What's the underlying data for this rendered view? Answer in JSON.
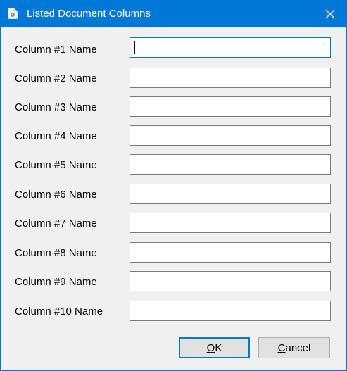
{
  "window": {
    "title": "Listed Document Columns",
    "accent_color": "#0078d7",
    "icon": "document-gear-icon",
    "close_icon": "close-icon"
  },
  "fields": [
    {
      "label": "Column #1 Name",
      "value": "",
      "focused": true
    },
    {
      "label": "Column #2 Name",
      "value": ""
    },
    {
      "label": "Column #3 Name",
      "value": ""
    },
    {
      "label": "Column #4 Name",
      "value": ""
    },
    {
      "label": "Column #5 Name",
      "value": ""
    },
    {
      "label": "Column #6 Name",
      "value": ""
    },
    {
      "label": "Column #7 Name",
      "value": ""
    },
    {
      "label": "Column #8 Name",
      "value": ""
    },
    {
      "label": "Column #9 Name",
      "value": ""
    },
    {
      "label": "Column #10 Name",
      "value": ""
    }
  ],
  "buttons": {
    "ok": {
      "mnemonic": "O",
      "rest": "K"
    },
    "cancel": {
      "mnemonic": "C",
      "rest": "ancel"
    }
  }
}
